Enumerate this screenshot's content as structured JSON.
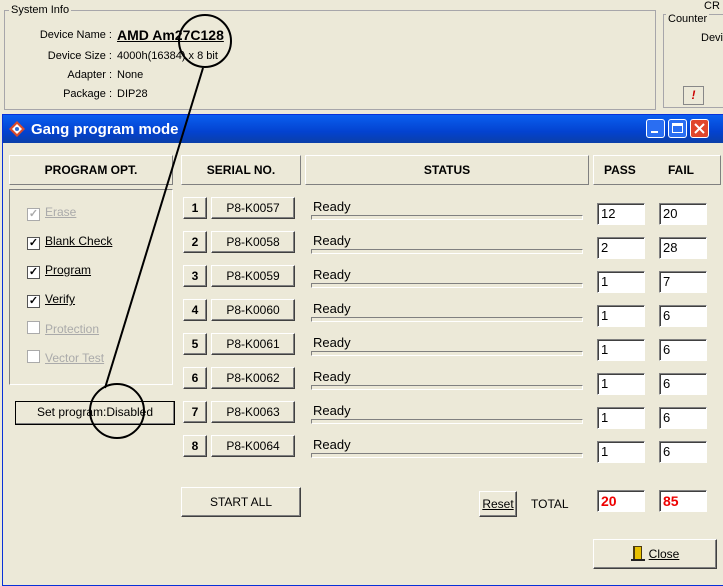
{
  "system_info": {
    "group_title": "System Info",
    "device_name_label": "Device Name :",
    "device_name": "AMD Am27C128",
    "device_size_label": "Device Size :",
    "device_size": "4000h(16384) x 8 bit",
    "adapter_label": "Adapter :",
    "adapter": "None",
    "package_label": "Package :",
    "package": "DIP28"
  },
  "counter": {
    "group_title": "Counter",
    "partial_top": "CR",
    "partial_label": "Devi",
    "warn": "!"
  },
  "dialog": {
    "title": "Gang program mode",
    "headers": {
      "program_opt": "PROGRAM OPT.",
      "serial": "SERIAL NO.",
      "status": "STATUS",
      "pass": "PASS",
      "fail": "FAIL"
    },
    "options": [
      {
        "label": "Erase",
        "checked": true,
        "enabled": false
      },
      {
        "label": "Blank Check",
        "checked": true,
        "enabled": true
      },
      {
        "label": "Program",
        "checked": true,
        "enabled": true
      },
      {
        "label": "Verify",
        "checked": true,
        "enabled": true
      },
      {
        "label": "Protection",
        "checked": false,
        "enabled": false
      },
      {
        "label": "Vector Test",
        "checked": false,
        "enabled": false
      }
    ],
    "set_program_button": "Set program:Disabled",
    "rows": [
      {
        "num": "1",
        "serial": "P8-K0057",
        "status": "Ready",
        "pass": "12",
        "fail": "20"
      },
      {
        "num": "2",
        "serial": "P8-K0058",
        "status": "Ready",
        "pass": "2",
        "fail": "28"
      },
      {
        "num": "3",
        "serial": "P8-K0059",
        "status": "Ready",
        "pass": "1",
        "fail": "7"
      },
      {
        "num": "4",
        "serial": "P8-K0060",
        "status": "Ready",
        "pass": "1",
        "fail": "6"
      },
      {
        "num": "5",
        "serial": "P8-K0061",
        "status": "Ready",
        "pass": "1",
        "fail": "6"
      },
      {
        "num": "6",
        "serial": "P8-K0062",
        "status": "Ready",
        "pass": "1",
        "fail": "6"
      },
      {
        "num": "7",
        "serial": "P8-K0063",
        "status": "Ready",
        "pass": "1",
        "fail": "6"
      },
      {
        "num": "8",
        "serial": "P8-K0064",
        "status": "Ready",
        "pass": "1",
        "fail": "6"
      }
    ],
    "start_all": "START ALL",
    "reset": "Reset",
    "total_label": "TOTAL",
    "total_pass": "20",
    "total_fail": "85",
    "close": "Close"
  },
  "colors": {
    "title_bar": "#0a5ff0",
    "total_text": "#ee0000",
    "close_button": "#e0462c"
  }
}
